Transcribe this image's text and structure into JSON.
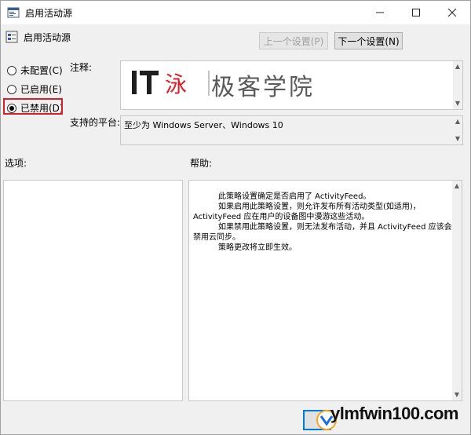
{
  "window": {
    "title": "启用活动源",
    "controls": {
      "minimize": "—",
      "maximize": "☐",
      "close": "✕"
    }
  },
  "policy": {
    "name": "启用活动源"
  },
  "nav": {
    "prev_label": "上一个设置(P)",
    "next_label": "下一个设置(N)"
  },
  "options_state": {
    "not_configured": "未配置(C)",
    "enabled": "已启用(E)",
    "disabled": "已禁用(D)",
    "selected": "disabled"
  },
  "labels": {
    "comment": "注释:",
    "platform": "支持的平台:",
    "options": "选项:",
    "help": "帮助:"
  },
  "comment_watermark": "极客学院",
  "platform_value": "至少为 Windows Server、Windows 10",
  "help_paragraphs": [
    "此策略设置确定是否启用了 ActivityFeed。",
    "如果启用此策略设置，则允许发布所有活动类型(如适用)，ActivityFeed 应在用户的设备图中漫游这些活动。",
    "如果禁用此策略设置，则无法发布活动，并且 ActivityFeed 应该会禁用云同步。",
    "策略更改将立即生效。"
  ],
  "bottom_watermark": "ylmfwin100.com",
  "colors": {
    "accent": "#0078d7",
    "highlight_box": "#d81e28"
  }
}
